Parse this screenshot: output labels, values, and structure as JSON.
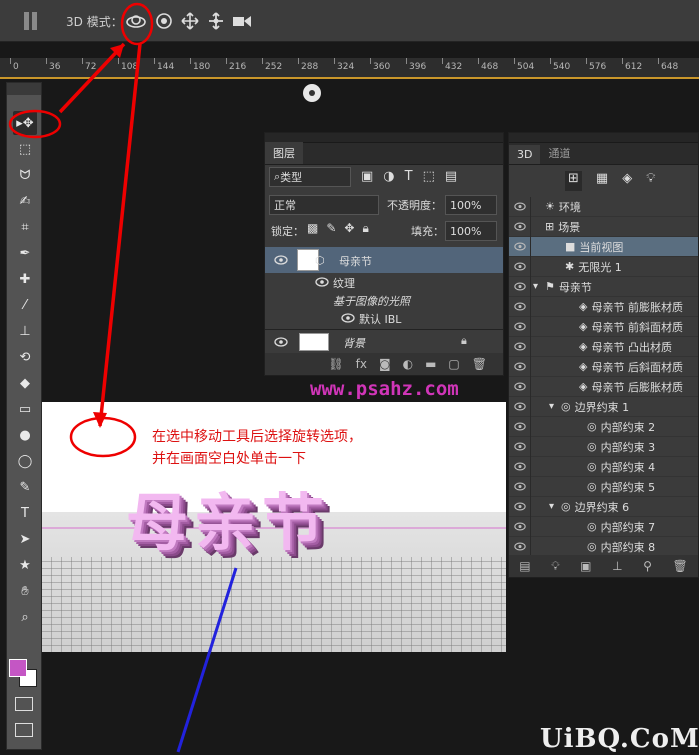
{
  "options_bar": {
    "mode_label": "3D 模式："
  },
  "ruler": {
    "labels": [
      "0",
      "36",
      "72",
      "108",
      "144",
      "180",
      "216",
      "252",
      "288",
      "324",
      "360",
      "396",
      "432",
      "468",
      "504",
      "540",
      "576",
      "612",
      "648"
    ]
  },
  "layers_panel": {
    "tab_label": "图层",
    "filter_kind": "类型",
    "blend_mode": "正常",
    "opacity_label": "不透明度：",
    "opacity_value": "100%",
    "lock_label": "锁定：",
    "fill_label": "填充：",
    "fill_value": "100%",
    "layers": [
      {
        "name": "母亲节"
      },
      {
        "name": "纹理"
      },
      {
        "name": "基于图像的光照"
      },
      {
        "name": "默认 IBL"
      },
      {
        "name": "背景"
      }
    ]
  },
  "website": "www.psahz.com",
  "annotation": {
    "line1": "在选中移动工具后选择旋转选项，",
    "line2": "并在画面空白处单击一下"
  },
  "canvas_text": "母亲节",
  "panel_3d": {
    "tabs": [
      "3D",
      "通道"
    ],
    "rows": [
      {
        "label": "环境"
      },
      {
        "label": "场景"
      },
      {
        "label": "当前视图"
      },
      {
        "label": "无限光 1"
      },
      {
        "label": "母亲节"
      },
      {
        "label": "母亲节 前膨胀材质"
      },
      {
        "label": "母亲节 前斜面材质"
      },
      {
        "label": "母亲节 凸出材质"
      },
      {
        "label": "母亲节 后斜面材质"
      },
      {
        "label": "母亲节 后膨胀材质"
      },
      {
        "label": "边界约束 1"
      },
      {
        "label": "内部约束 2"
      },
      {
        "label": "内部约束 3"
      },
      {
        "label": "内部约束 4"
      },
      {
        "label": "内部约束 5"
      },
      {
        "label": "边界约束 6"
      },
      {
        "label": "内部约束 7"
      },
      {
        "label": "内部约束 8"
      }
    ]
  },
  "watermark": "UiBQ.CoM",
  "colors": {
    "annotation_red": "#dd1111",
    "foreground_swatch": "#c456c4",
    "highlight_row": "#5a6e80",
    "website_text": "#d035b8"
  }
}
